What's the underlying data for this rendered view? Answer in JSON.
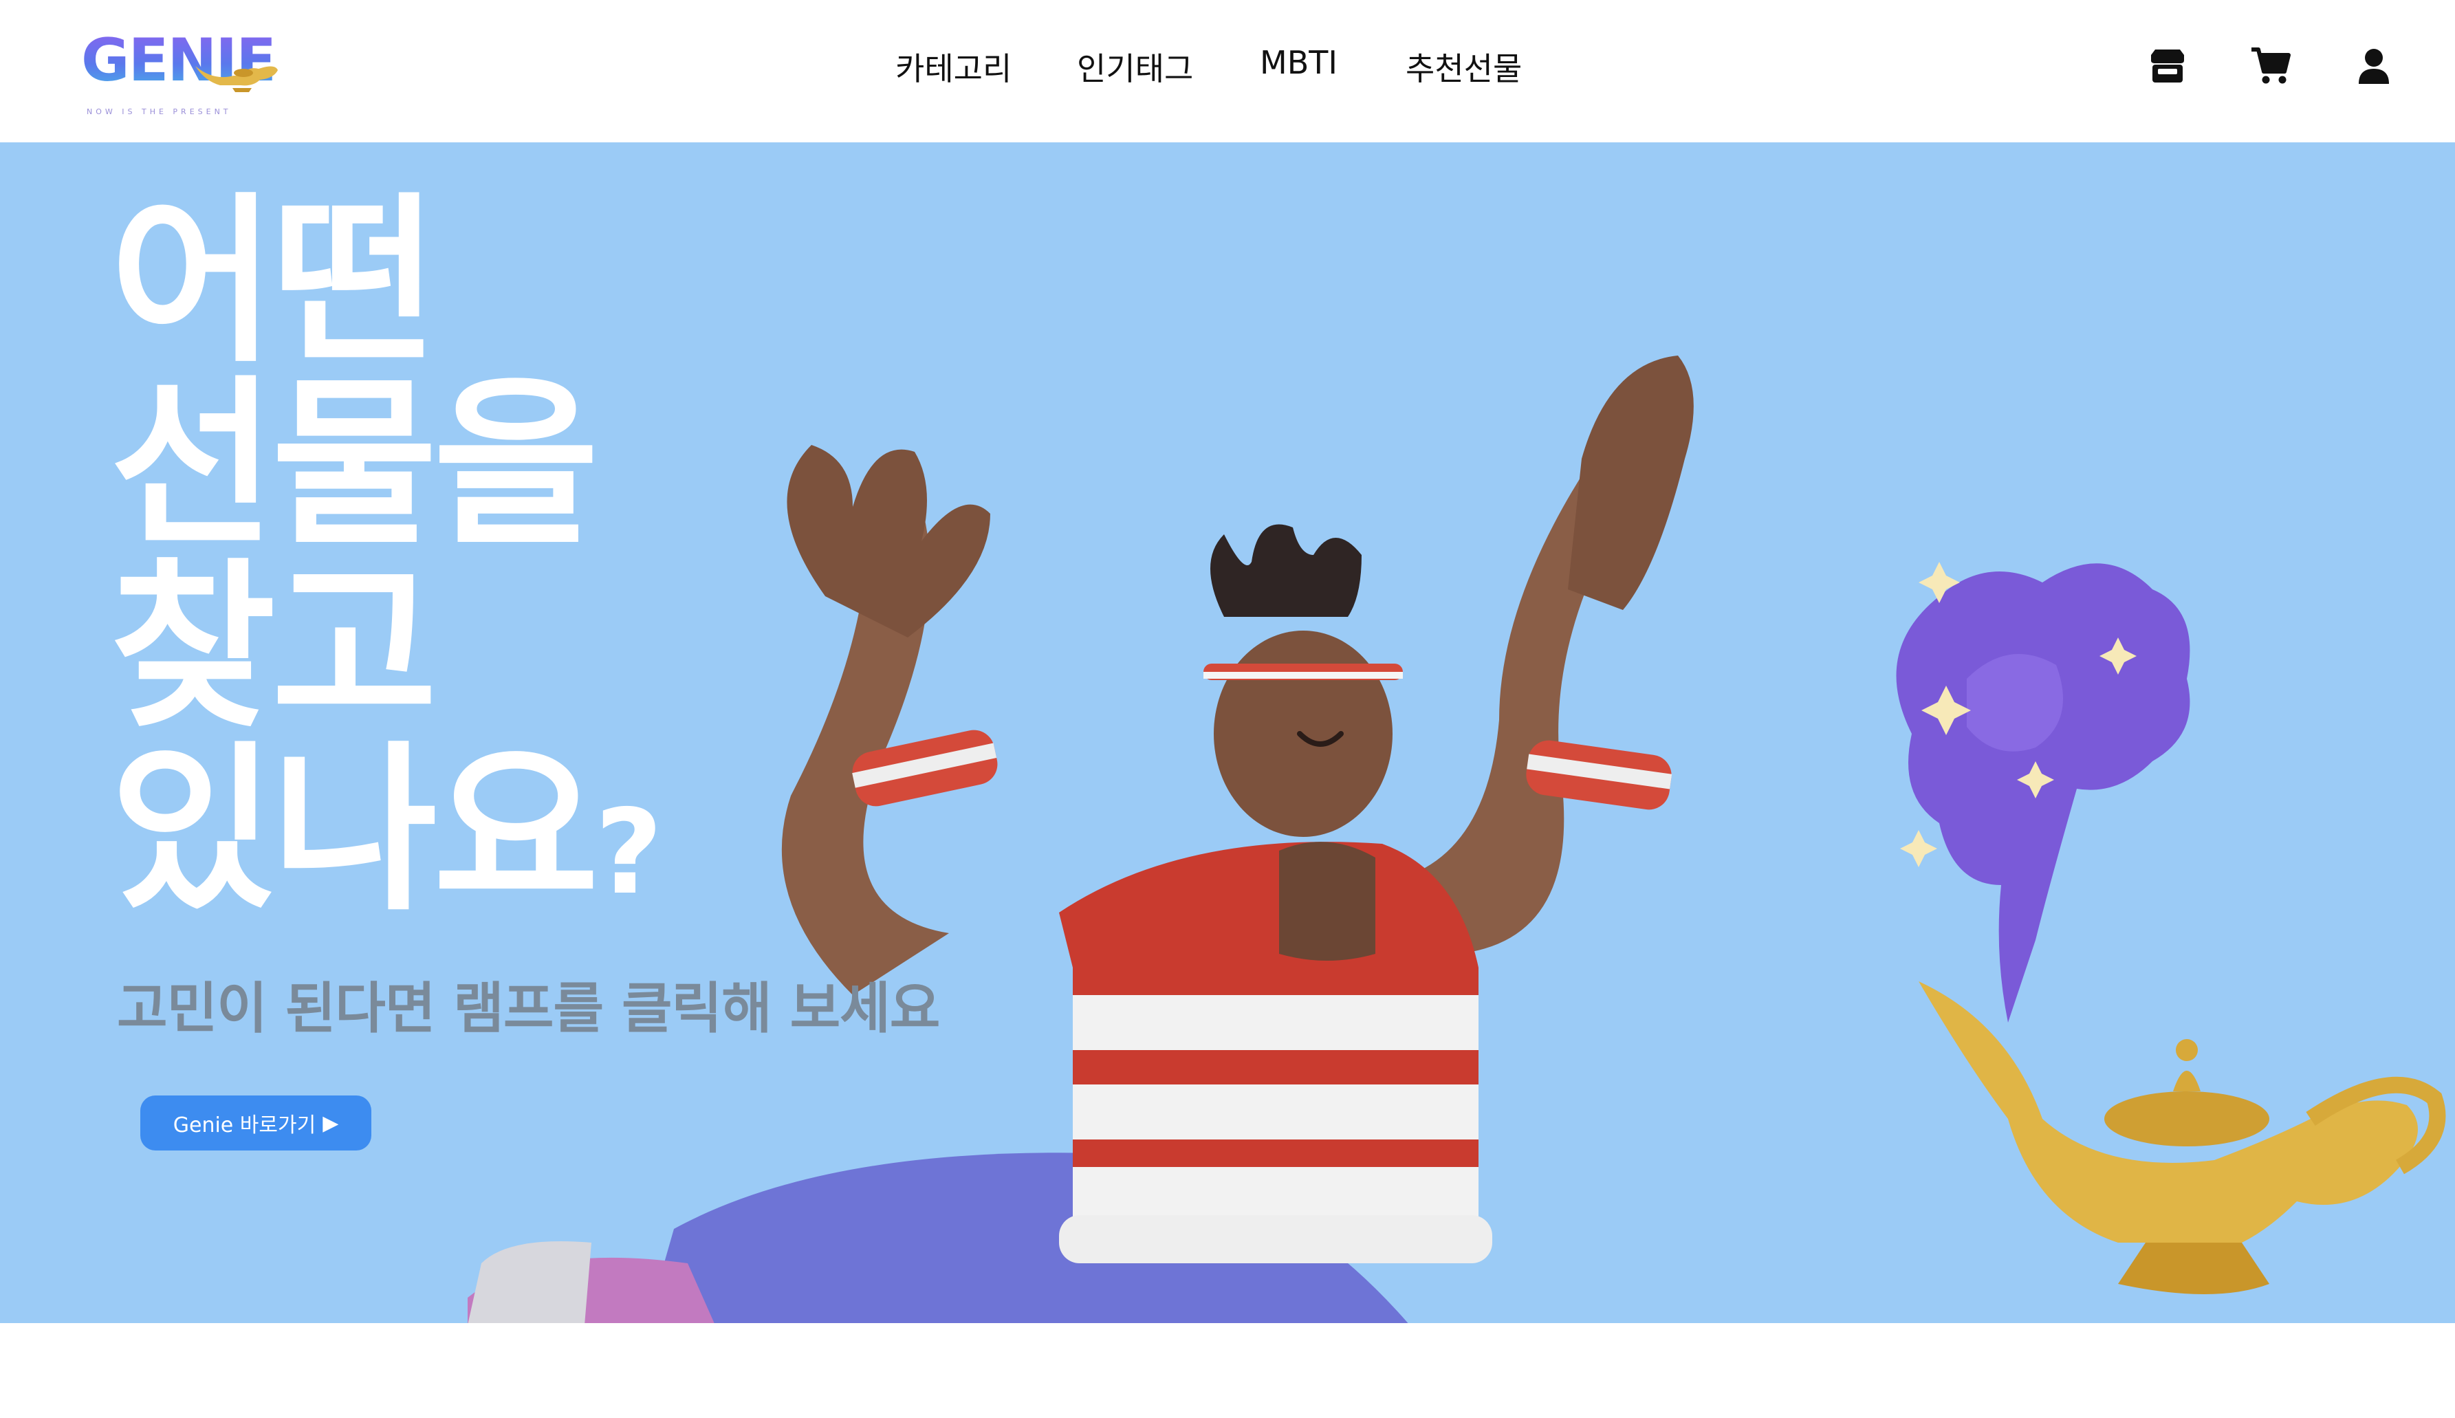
{
  "header": {
    "logo_text": "GENIE",
    "logo_sub": "NOW IS THE PRESENT",
    "nav": [
      "카테고리",
      "인기태그",
      "MBTI",
      "추천선물"
    ],
    "icons": [
      "store-icon",
      "cart-icon",
      "user-icon"
    ]
  },
  "hero": {
    "headline": [
      "어떤",
      "선물을",
      "찾고",
      "있나요"
    ],
    "question_mark": "?",
    "subline": "고민이 된다면 램프를 클릭해 보세요",
    "cta_label": "Genie 바로가기",
    "cta_arrow": "▶"
  },
  "colors": {
    "hero_bg": "#9bcbf6",
    "cta_bg": "#3d8cf0",
    "headline": "#ffffff",
    "subline": "#7a8a9a"
  }
}
